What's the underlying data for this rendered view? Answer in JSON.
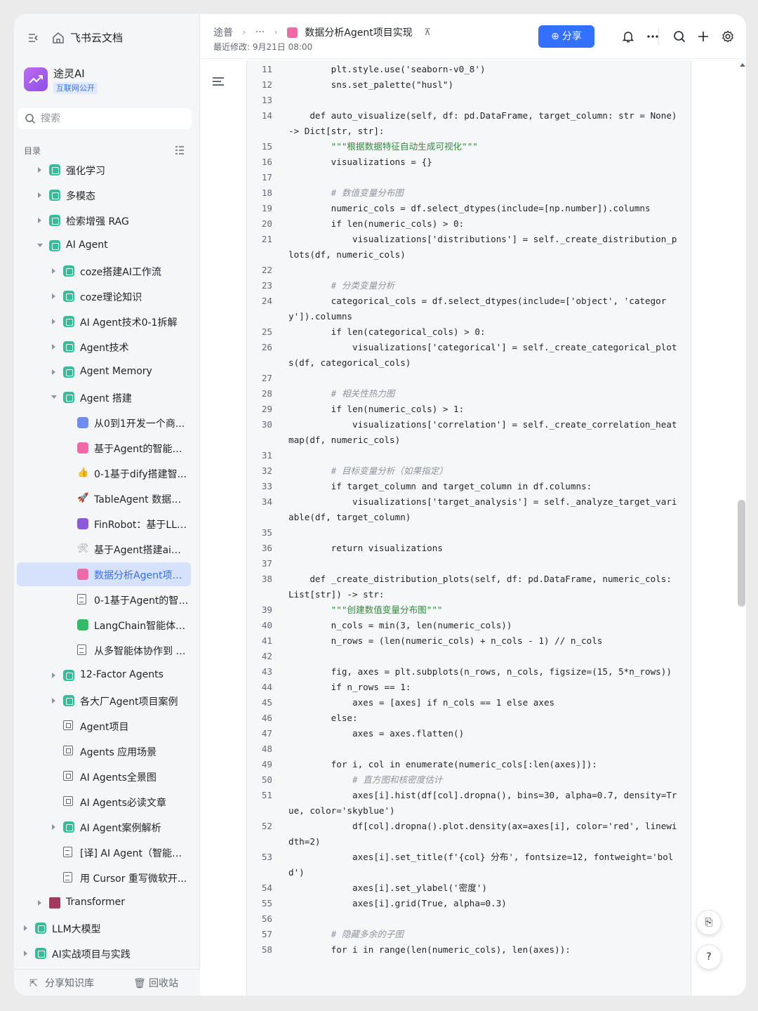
{
  "sidebar": {
    "brand": "飞书云文档",
    "kb_name": "途灵AI",
    "kb_badge": "互联网公开",
    "search_placeholder": "搜索",
    "toc_label": "目录",
    "footer_share": "分享知识库",
    "footer_trash": "回收站",
    "items": [
      {
        "label": "强化学习",
        "level": 0,
        "arrow": "right",
        "icon": "teal"
      },
      {
        "label": "多模态",
        "level": 0,
        "arrow": "right",
        "icon": "teal"
      },
      {
        "label": "检索增强 RAG",
        "level": 0,
        "arrow": "right",
        "icon": "teal"
      },
      {
        "label": "AI Agent",
        "level": 0,
        "arrow": "down",
        "icon": "teal"
      },
      {
        "label": "coze搭建AI工作流",
        "level": 1,
        "arrow": "right",
        "icon": "teal"
      },
      {
        "label": "coze理论知识",
        "level": 1,
        "arrow": "right",
        "icon": "teal"
      },
      {
        "label": "AI Agent技术0-1拆解",
        "level": 1,
        "arrow": "right",
        "icon": "teal"
      },
      {
        "label": "Agent技术",
        "level": 1,
        "arrow": "right",
        "icon": "teal"
      },
      {
        "label": "Agent Memory",
        "level": 1,
        "arrow": "right",
        "icon": "teal"
      },
      {
        "label": "Agent 搭建",
        "level": 1,
        "arrow": "down",
        "icon": "teal"
      },
      {
        "label": "从0到1开发一个商...",
        "level": 2,
        "arrow": "",
        "icon": "blue"
      },
      {
        "label": "基于Agent的智能客...",
        "level": 2,
        "arrow": "",
        "icon": "pink"
      },
      {
        "label": "0-1基于dify搭建智...",
        "level": 2,
        "arrow": "",
        "icon": "orange"
      },
      {
        "label": "TableAgent 数据分...",
        "level": 2,
        "arrow": "",
        "icon": "rocket"
      },
      {
        "label": "FinRobot：基于LLM...",
        "level": 2,
        "arrow": "",
        "icon": "purple"
      },
      {
        "label": "基于Agent搭建ai论...",
        "level": 2,
        "arrow": "",
        "icon": "tools"
      },
      {
        "label": "数据分析Agent项目...",
        "level": 2,
        "arrow": "",
        "icon": "pink",
        "selected": true
      },
      {
        "label": "0-1基于Agent的智能...",
        "level": 2,
        "arrow": "",
        "icon": "doc"
      },
      {
        "label": "LangChain智能体开...",
        "level": 2,
        "arrow": "",
        "icon": "green"
      },
      {
        "label": "从多智能体协作到 A...",
        "level": 2,
        "arrow": "",
        "icon": "doc"
      },
      {
        "label": "12-Factor Agents",
        "level": 1,
        "arrow": "right",
        "icon": "teal"
      },
      {
        "label": "各大厂Agent项目案例",
        "level": 1,
        "arrow": "right",
        "icon": "teal"
      },
      {
        "label": "Agent项目",
        "level": 1,
        "arrow": "",
        "icon": "box"
      },
      {
        "label": "Agents 应用场景",
        "level": 1,
        "arrow": "",
        "icon": "box"
      },
      {
        "label": "AI Agents全景图",
        "level": 1,
        "arrow": "",
        "icon": "box"
      },
      {
        "label": "AI Agents必读文章",
        "level": 1,
        "arrow": "",
        "icon": "box"
      },
      {
        "label": "AI Agent案例解析",
        "level": 1,
        "arrow": "right",
        "icon": "teal"
      },
      {
        "label": "[译] AI Agent（智能体...",
        "level": 1,
        "arrow": "",
        "icon": "doc"
      },
      {
        "label": "用 Cursor 重写微软开...",
        "level": 1,
        "arrow": "",
        "icon": "doc"
      },
      {
        "label": "Transformer",
        "level": 0,
        "arrow": "right",
        "icon": "save"
      },
      {
        "label": "LLM大模型",
        "level": -1,
        "arrow": "right",
        "icon": "teal"
      },
      {
        "label": "AI实战项目与实践",
        "level": -1,
        "arrow": "right",
        "icon": "teal"
      }
    ]
  },
  "header": {
    "crumb_root": "途普",
    "crumb_more": "···",
    "crumb_current": "数据分析Agent项目实现",
    "pin_icon": "pin-icon",
    "modified": "最近修改: 9月21日 08:00",
    "share_label": "分享"
  },
  "code_lines": [
    {
      "n": "11",
      "t": "        plt.style.use('seaborn-v0_8')",
      "k": ""
    },
    {
      "n": "12",
      "t": "        sns.set_palette(\"husl\")",
      "k": ""
    },
    {
      "n": "13",
      "t": "",
      "k": ""
    },
    {
      "n": "14",
      "t": "    def auto_visualize(self, df: pd.DataFrame, target_column: str = None) -> Dict[str, str]:",
      "k": ""
    },
    {
      "n": "15",
      "t": "        \"\"\"根据数据特征自动生成可视化\"\"\"",
      "k": "docstr"
    },
    {
      "n": "16",
      "t": "        visualizations = {}",
      "k": ""
    },
    {
      "n": "17",
      "t": "",
      "k": ""
    },
    {
      "n": "18",
      "t": "        # 数值变量分布图",
      "k": "comment"
    },
    {
      "n": "19",
      "t": "        numeric_cols = df.select_dtypes(include=[np.number]).columns",
      "k": ""
    },
    {
      "n": "20",
      "t": "        if len(numeric_cols) > 0:",
      "k": ""
    },
    {
      "n": "21",
      "t": "            visualizations['distributions'] = self._create_distribution_plots(df, numeric_cols)",
      "k": ""
    },
    {
      "n": "22",
      "t": "",
      "k": ""
    },
    {
      "n": "23",
      "t": "        # 分类变量分析",
      "k": "comment"
    },
    {
      "n": "24",
      "t": "        categorical_cols = df.select_dtypes(include=['object', 'category']).columns",
      "k": ""
    },
    {
      "n": "25",
      "t": "        if len(categorical_cols) > 0:",
      "k": ""
    },
    {
      "n": "26",
      "t": "            visualizations['categorical'] = self._create_categorical_plots(df, categorical_cols)",
      "k": ""
    },
    {
      "n": "27",
      "t": "",
      "k": ""
    },
    {
      "n": "28",
      "t": "        # 相关性热力图",
      "k": "comment"
    },
    {
      "n": "29",
      "t": "        if len(numeric_cols) > 1:",
      "k": ""
    },
    {
      "n": "30",
      "t": "            visualizations['correlation'] = self._create_correlation_heatmap(df, numeric_cols)",
      "k": ""
    },
    {
      "n": "31",
      "t": "",
      "k": ""
    },
    {
      "n": "32",
      "t": "        # 目标变量分析（如果指定）",
      "k": "comment"
    },
    {
      "n": "33",
      "t": "        if target_column and target_column in df.columns:",
      "k": ""
    },
    {
      "n": "34",
      "t": "            visualizations['target_analysis'] = self._analyze_target_variable(df, target_column)",
      "k": ""
    },
    {
      "n": "35",
      "t": "",
      "k": ""
    },
    {
      "n": "36",
      "t": "        return visualizations",
      "k": ""
    },
    {
      "n": "37",
      "t": "",
      "k": ""
    },
    {
      "n": "38",
      "t": "    def _create_distribution_plots(self, df: pd.DataFrame, numeric_cols: List[str]) -> str:",
      "k": ""
    },
    {
      "n": "39",
      "t": "        \"\"\"创建数值变量分布图\"\"\"",
      "k": "docstr"
    },
    {
      "n": "40",
      "t": "        n_cols = min(3, len(numeric_cols))",
      "k": ""
    },
    {
      "n": "41",
      "t": "        n_rows = (len(numeric_cols) + n_cols - 1) // n_cols",
      "k": ""
    },
    {
      "n": "42",
      "t": "",
      "k": ""
    },
    {
      "n": "43",
      "t": "        fig, axes = plt.subplots(n_rows, n_cols, figsize=(15, 5*n_rows))",
      "k": ""
    },
    {
      "n": "44",
      "t": "        if n_rows == 1:",
      "k": ""
    },
    {
      "n": "45",
      "t": "            axes = [axes] if n_cols == 1 else axes",
      "k": ""
    },
    {
      "n": "46",
      "t": "        else:",
      "k": ""
    },
    {
      "n": "47",
      "t": "            axes = axes.flatten()",
      "k": ""
    },
    {
      "n": "48",
      "t": "",
      "k": ""
    },
    {
      "n": "49",
      "t": "        for i, col in enumerate(numeric_cols[:len(axes)]):",
      "k": ""
    },
    {
      "n": "50",
      "t": "            # 直方图和核密度估计",
      "k": "comment"
    },
    {
      "n": "51",
      "t": "            axes[i].hist(df[col].dropna(), bins=30, alpha=0.7, density=True, color='skyblue')",
      "k": ""
    },
    {
      "n": "52",
      "t": "            df[col].dropna().plot.density(ax=axes[i], color='red', linewidth=2)",
      "k": ""
    },
    {
      "n": "53",
      "t": "            axes[i].set_title(f'{col} 分布', fontsize=12, fontweight='bold')",
      "k": ""
    },
    {
      "n": "54",
      "t": "            axes[i].set_ylabel('密度')",
      "k": ""
    },
    {
      "n": "55",
      "t": "            axes[i].grid(True, alpha=0.3)",
      "k": ""
    },
    {
      "n": "56",
      "t": "",
      "k": ""
    },
    {
      "n": "57",
      "t": "        # 隐藏多余的子图",
      "k": "comment"
    },
    {
      "n": "58",
      "t": "        for i in range(len(numeric_cols), len(axes)):",
      "k": ""
    }
  ],
  "colors": {
    "accent": "#3370ff",
    "selected_bg": "#d6e1fb",
    "code_bg": "#f6f7f9"
  }
}
